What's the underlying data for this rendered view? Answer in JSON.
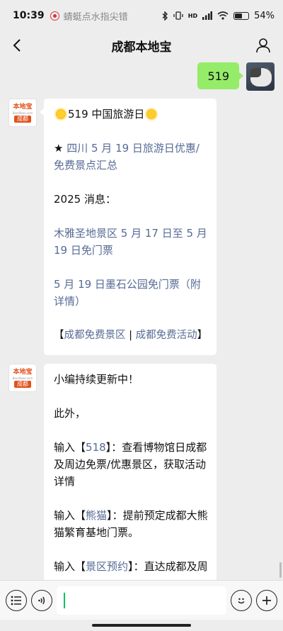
{
  "status_bar": {
    "time": "10:39",
    "notice_text": "蜻蜓点水指尖错",
    "network_label": "HD",
    "battery_percent": "54%"
  },
  "header": {
    "title": "成都本地宝"
  },
  "outgoing_message": {
    "text": "519"
  },
  "brand_avatar": {
    "top": "本地宝",
    "mid": "Bendibao.com",
    "bottom": "成都"
  },
  "message_1": {
    "title": "519 中国旅游日",
    "star_prefix": "★ ",
    "link1": "四川 5 月 19 日旅游日优惠/免费景点汇总",
    "news_label": "2025 消息：",
    "link2": "木雅圣地景区 5 月 17 日至 5 月 19 日免门票",
    "link3": "5 月 19 日墨石公园免门票（附详情",
    "link3_tail": "）",
    "bracket_open": "【",
    "link4": "成都免费景区",
    "sep": " | ",
    "link5": "成都免费活动",
    "bracket_close": "】"
  },
  "message_2": {
    "line1": "小编持续更新中！",
    "line2": "此外，",
    "input_prefix": "输入",
    "kw1_open": "【",
    "kw1": "518",
    "kw1_close": "】",
    "kw1_desc": "：查看博物馆日成都及周边免票/优惠景区，获取活动详情",
    "kw2_open": "【",
    "kw2": "熊猫",
    "kw2_close": "】",
    "kw2_desc": "：提前预定成都大熊猫繁育基地门票。",
    "kw3_open": "【",
    "kw3": "景区预约",
    "kw3_close": "】",
    "kw3_desc": "：直达成都及周"
  },
  "input_bar": {
    "placeholder": ""
  },
  "colors": {
    "link": "#576b95",
    "outgoing_bubble": "#95ec69",
    "background": "#ededed"
  }
}
